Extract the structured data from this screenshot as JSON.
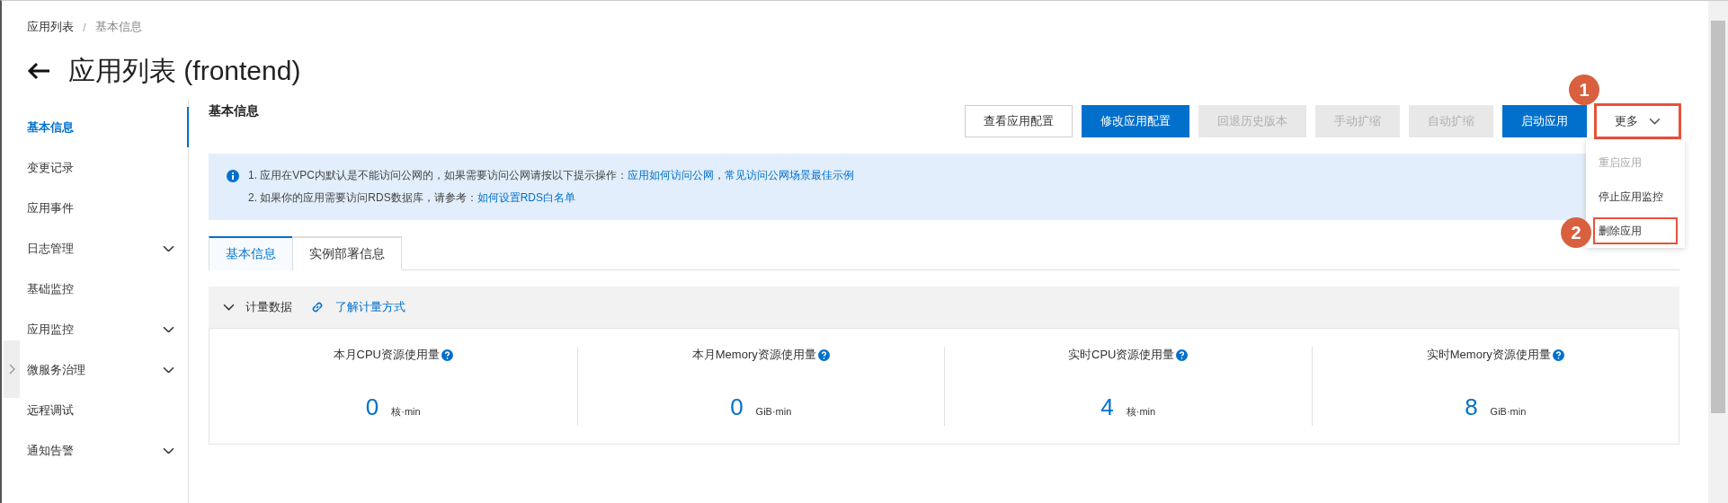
{
  "breadcrumb": [
    {
      "label": "应用列表"
    },
    {
      "label": "基本信息"
    }
  ],
  "breadcrumb_separator": "/",
  "page_title": "应用列表 (frontend)",
  "sidebar": {
    "items": [
      {
        "label": "基本信息",
        "selected": true,
        "expandable": false
      },
      {
        "label": "变更记录",
        "selected": false,
        "expandable": false
      },
      {
        "label": "应用事件",
        "selected": false,
        "expandable": false
      },
      {
        "label": "日志管理",
        "selected": false,
        "expandable": true
      },
      {
        "label": "基础监控",
        "selected": false,
        "expandable": false
      },
      {
        "label": "应用监控",
        "selected": false,
        "expandable": true
      },
      {
        "label": "微服务治理",
        "selected": false,
        "expandable": true
      },
      {
        "label": "远程调试",
        "selected": false,
        "expandable": false
      },
      {
        "label": "通知告警",
        "selected": false,
        "expandable": true
      }
    ]
  },
  "section_title": "基本信息",
  "toolbar": {
    "buttons": [
      {
        "label": "查看应用配置",
        "kind": "default",
        "disabled": false
      },
      {
        "label": "修改应用配置",
        "kind": "primary",
        "disabled": false
      },
      {
        "label": "回退历史版本",
        "kind": "default",
        "disabled": true
      },
      {
        "label": "手动扩缩",
        "kind": "default",
        "disabled": true
      },
      {
        "label": "自动扩缩",
        "kind": "default",
        "disabled": true
      },
      {
        "label": "启动应用",
        "kind": "primary",
        "disabled": false
      },
      {
        "label": "更多",
        "kind": "dropdown",
        "disabled": false,
        "highlighted": true
      }
    ]
  },
  "more_menu": {
    "expanded": true,
    "items": [
      {
        "label": "重启应用",
        "disabled": true,
        "highlighted": false
      },
      {
        "label": "停止应用监控",
        "disabled": false,
        "highlighted": false
      },
      {
        "label": "删除应用",
        "disabled": false,
        "highlighted": true
      }
    ]
  },
  "callouts": [
    {
      "number": "1"
    },
    {
      "number": "2"
    }
  ],
  "notice": {
    "lines": [
      {
        "text": "1. 应用在VPC内默认是不能访问公网的，如果需要访问公网请按以下提示操作：",
        "links": [
          "应用如何访问公网",
          "常见访问公网场景最佳示例"
        ],
        "link_separator": "，"
      },
      {
        "text": "2. 如果你的应用需要访问RDS数据库，请参考：",
        "links": [
          "如何设置RDS白名单"
        ]
      }
    ]
  },
  "tabs": [
    {
      "label": "基本信息",
      "selected": true
    },
    {
      "label": "实例部署信息",
      "selected": false
    }
  ],
  "metering": {
    "title": "计量数据",
    "expanded": true,
    "link": "了解计量方式",
    "metrics": [
      {
        "label": "本月CPU资源使用量",
        "value": "0",
        "unit": "核·min"
      },
      {
        "label": "本月Memory资源使用量",
        "value": "0",
        "unit": "GiB·min"
      },
      {
        "label": "实时CPU资源使用量",
        "value": "4",
        "unit": "核·min"
      },
      {
        "label": "实时Memory资源使用量",
        "value": "8",
        "unit": "GiB·min"
      }
    ]
  }
}
